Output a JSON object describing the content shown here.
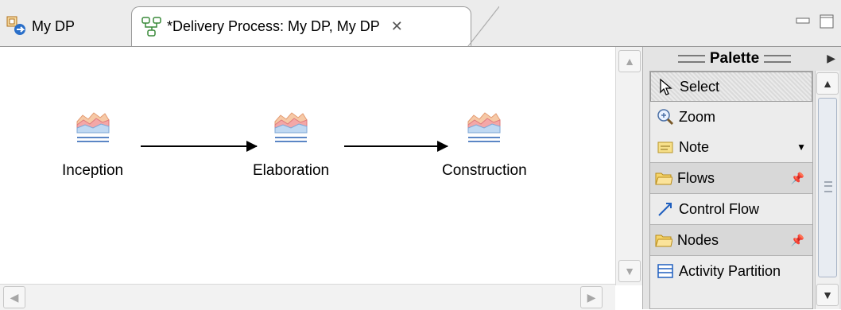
{
  "tabs": [
    {
      "label": "My DP",
      "icon": "process-icon",
      "active": false
    },
    {
      "label": "*Delivery Process: My DP, My DP",
      "icon": "activity-diagram-icon",
      "active": true,
      "close_icon": "close-icon"
    }
  ],
  "window_controls": [
    "minimize-icon",
    "maximize-icon"
  ],
  "diagram": {
    "nodes": [
      {
        "label": "Inception",
        "icon": "phase-icon"
      },
      {
        "label": "Elaboration",
        "icon": "phase-icon"
      },
      {
        "label": "Construction",
        "icon": "phase-icon"
      }
    ],
    "connections": [
      "Inception → Elaboration",
      "Elaboration → Construction"
    ]
  },
  "palette": {
    "title": "Palette",
    "tools": [
      {
        "label": "Select",
        "icon": "cursor-icon",
        "selected": true
      },
      {
        "label": "Zoom",
        "icon": "zoom-icon"
      },
      {
        "label": "Note",
        "icon": "note-icon"
      }
    ],
    "drawers": [
      {
        "label": "Flows",
        "icon": "folder-icon",
        "items": [
          {
            "label": "Control Flow",
            "icon": "control-flow-icon"
          }
        ]
      },
      {
        "label": "Nodes",
        "icon": "folder-icon",
        "items": [
          {
            "label": "Activity Partition",
            "icon": "partition-icon"
          }
        ]
      }
    ]
  },
  "colors": {
    "tab_bar": "#ececec",
    "palette_bg": "#e4e4e4",
    "drawer_bg": "#d8d8d8",
    "folder": "#f0c040"
  }
}
